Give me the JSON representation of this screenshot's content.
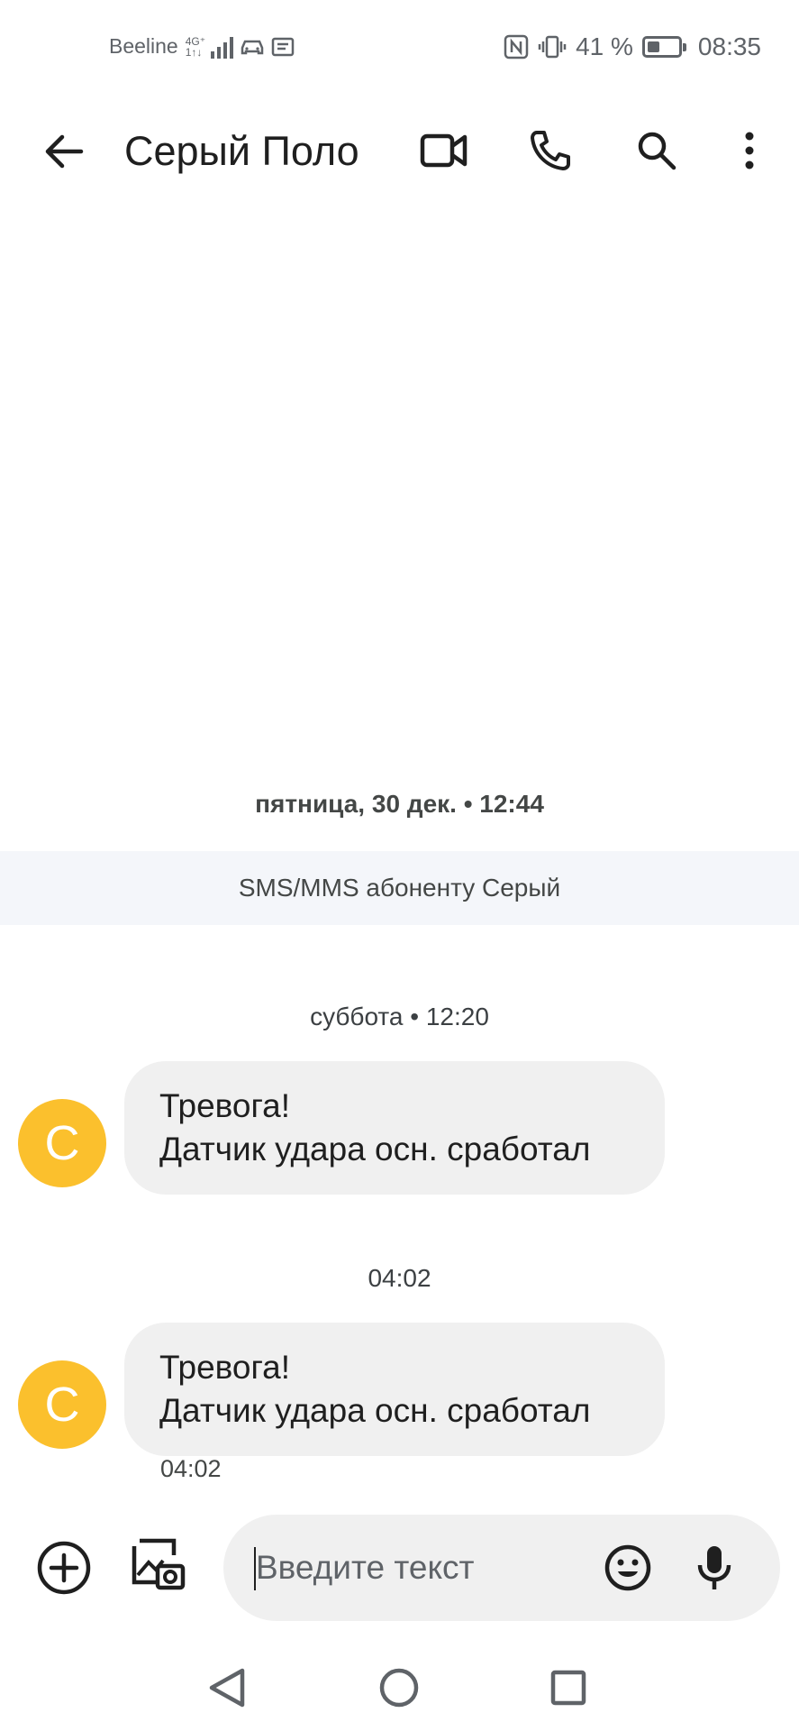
{
  "status_bar": {
    "carrier": "Beeline",
    "network_type": "4G⁺",
    "network_sub": "1↑↓",
    "battery_percent": "41 %",
    "battery_level": 0.41,
    "time": "08:35"
  },
  "app_bar": {
    "back_icon": "arrow-left-icon",
    "title": "Серый Поло",
    "actions": [
      "video-call-icon",
      "phone-icon",
      "search-icon",
      "more-vert-icon"
    ]
  },
  "conversation": {
    "date_1": "пятница, 30 дек. • 12:44",
    "banner": "SMS/MMS абоненту Серый",
    "date_2": "суббота • 12:20",
    "messages": [
      {
        "avatar_letter": "С",
        "line1": "Тревога!",
        "line2": "Датчик удара осн. сработал"
      },
      {
        "avatar_letter": "С",
        "line1": "Тревога!",
        "line2": "Датчик удара осн. сработал",
        "time": "04:02"
      }
    ],
    "time_sep": "04:02"
  },
  "compose": {
    "placeholder": "Введите текст",
    "icons": [
      "add-circle-icon",
      "gallery-camera-icon",
      "emoji-icon",
      "microphone-icon"
    ]
  },
  "nav": {
    "buttons": [
      "back-triangle-icon",
      "home-circle-icon",
      "recents-square-icon"
    ]
  },
  "colors": {
    "avatar": "#fbc02d",
    "bubble": "#f0f0f0",
    "banner": "#f4f6fa"
  }
}
